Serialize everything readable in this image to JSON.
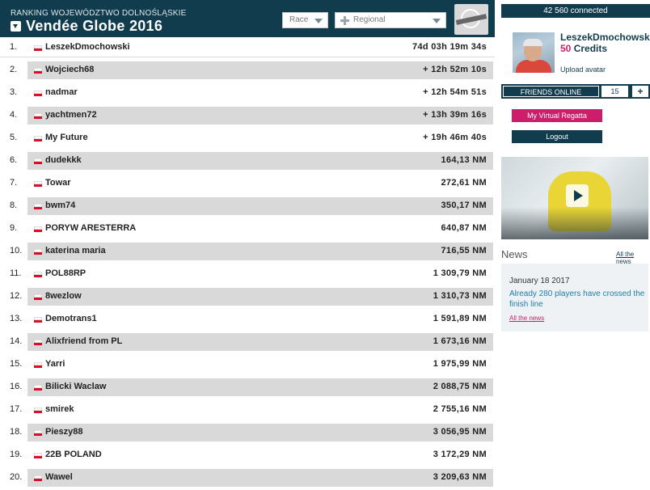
{
  "header": {
    "subtitle": "RANKING WOJEWÓDZTWO DOLNOŚLĄSKIE",
    "title": "Vendée Globe 2016",
    "race_select": "Race",
    "region_select": "Regional"
  },
  "ranking": [
    {
      "rank": "1.",
      "name": "LeszekDmochowski",
      "value": "74d 03h 19m 34s"
    },
    {
      "rank": "2.",
      "name": "Wojciech68",
      "value": "+ 12h 52m 10s"
    },
    {
      "rank": "3.",
      "name": "nadmar",
      "value": "+ 12h 54m 51s"
    },
    {
      "rank": "4.",
      "name": "yachtmen72",
      "value": "+ 13h 39m 16s"
    },
    {
      "rank": "5.",
      "name": "My Future",
      "value": "+ 19h 46m 40s"
    },
    {
      "rank": "6.",
      "name": "dudekkk",
      "value": "164,13 NM"
    },
    {
      "rank": "7.",
      "name": "Towar",
      "value": "272,61 NM"
    },
    {
      "rank": "8.",
      "name": "bwm74",
      "value": "350,17 NM"
    },
    {
      "rank": "9.",
      "name": "PORYW ARESTERRA",
      "value": "640,87 NM"
    },
    {
      "rank": "10.",
      "name": "katerina maria",
      "value": "716,55 NM"
    },
    {
      "rank": "11.",
      "name": "POL88RP",
      "value": "1 309,79 NM"
    },
    {
      "rank": "12.",
      "name": "8wezlow",
      "value": "1 310,73 NM"
    },
    {
      "rank": "13.",
      "name": "Demotrans1",
      "value": "1 591,89 NM"
    },
    {
      "rank": "14.",
      "name": "Alixfriend from PL",
      "value": "1 673,16 NM"
    },
    {
      "rank": "15.",
      "name": "Yarri",
      "value": "1 975,99 NM"
    },
    {
      "rank": "16.",
      "name": "Bilicki Waclaw",
      "value": "2 088,75 NM"
    },
    {
      "rank": "17.",
      "name": "smirek",
      "value": "2 755,16 NM"
    },
    {
      "rank": "18.",
      "name": "Pieszy88",
      "value": "3 056,95 NM"
    },
    {
      "rank": "19.",
      "name": "22B POLAND",
      "value": "3 172,29 NM"
    },
    {
      "rank": "20.",
      "name": "Wawel",
      "value": "3 209,63 NM"
    }
  ],
  "sidebar": {
    "connected": "42 560 connected",
    "username": "LeszekDmochowski",
    "credits_number": "50",
    "credits_label": "Credits",
    "upload_avatar": "Upload avatar",
    "friends_label": "FRIENDS ONLINE",
    "friends_count": "15",
    "friends_add": "+",
    "my_virtual_regatta": "My Virtual Regatta",
    "logout": "Logout",
    "news_title": "News",
    "all_news": "All the news",
    "news_date": "January 18 2017",
    "news_text": "Already 280 players have crossed the finish line",
    "all_news_2": "All the news"
  },
  "colors": {
    "navy": "#113c4d",
    "pink": "#cc1e6a",
    "row_shade": "#d9d9d9",
    "flag_red": "#d9102a"
  },
  "icons": {
    "title_toggle": "triangle-down-icon",
    "region_select": "cross-icon",
    "flag": "poland-flag-icon",
    "video": "play-icon"
  }
}
